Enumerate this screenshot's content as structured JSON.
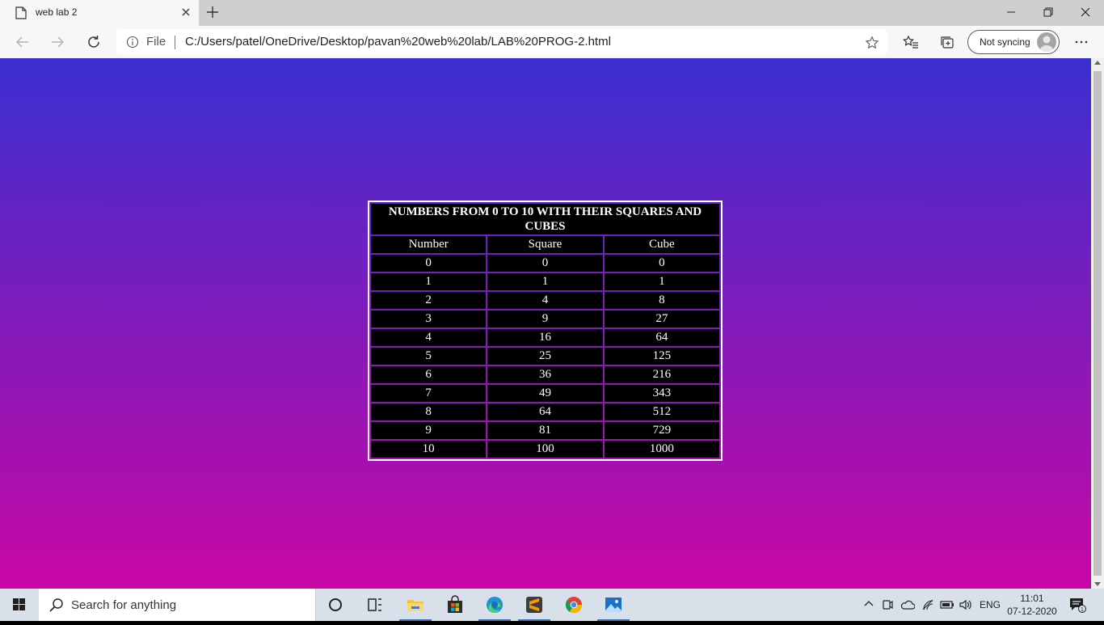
{
  "browser": {
    "tab_title": "web lab 2",
    "address_scheme": "File",
    "url": "C:/Users/patel/OneDrive/Desktop/pavan%20web%20lab/LAB%20PROG-2.html",
    "sync_label": "Not syncing"
  },
  "page": {
    "background_colors": [
      "#3a2fd0",
      "#c807a4"
    ],
    "table_caption": "NUMBERS FROM 0 TO 10 WITH THEIR SQUARES AND CUBES",
    "headers": [
      "Number",
      "Square",
      "Cube"
    ],
    "rows": [
      [
        "0",
        "0",
        "0"
      ],
      [
        "1",
        "1",
        "1"
      ],
      [
        "2",
        "4",
        "8"
      ],
      [
        "3",
        "9",
        "27"
      ],
      [
        "4",
        "16",
        "64"
      ],
      [
        "5",
        "25",
        "125"
      ],
      [
        "6",
        "36",
        "216"
      ],
      [
        "7",
        "49",
        "343"
      ],
      [
        "8",
        "64",
        "512"
      ],
      [
        "9",
        "81",
        "729"
      ],
      [
        "10",
        "100",
        "1000"
      ]
    ]
  },
  "taskbar": {
    "search_placeholder": "Search for anything",
    "apps": [
      "cortana-icon",
      "task-view-icon",
      "file-explorer-icon",
      "store-icon",
      "edge-icon",
      "sublime-text-icon",
      "chrome-icon",
      "photos-icon"
    ],
    "language": "ENG",
    "time": "11:01",
    "date": "07-12-2020",
    "notification_count": "1"
  }
}
